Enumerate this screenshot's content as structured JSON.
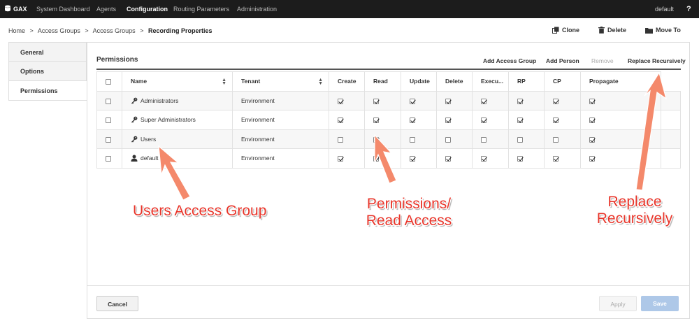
{
  "topnav": {
    "brand": "GAX",
    "items": [
      "System Dashboard",
      "Agents",
      "Configuration",
      "Routing Parameters",
      "Administration"
    ],
    "active": "Configuration",
    "user": "default",
    "help": "?"
  },
  "breadcrumb": {
    "items": [
      "Home",
      "Access Groups",
      "Access Groups"
    ],
    "separator": ">",
    "current": "Recording Properties"
  },
  "toolbar": {
    "clone": "Clone",
    "delete": "Delete",
    "move_to": "Move To"
  },
  "sidetabs": [
    "General",
    "Options",
    "Permissions"
  ],
  "active_tab": "Permissions",
  "panel": {
    "title": "Permissions",
    "actions": {
      "add_access_group": "Add Access Group",
      "add_person": "Add Person",
      "remove": "Remove",
      "replace_recursively": "Replace Recursively"
    }
  },
  "table": {
    "columns": [
      "Name",
      "Tenant",
      "Create",
      "Read",
      "Update",
      "Delete",
      "Execu...",
      "RP",
      "CP",
      "Propagate"
    ],
    "rows": [
      {
        "name": "Administrators",
        "icon": "key-icon",
        "tenant": "Environment",
        "perms": [
          true,
          true,
          true,
          true,
          true,
          true,
          true,
          true
        ]
      },
      {
        "name": "Super Administrators",
        "icon": "key-icon",
        "tenant": "Environment",
        "perms": [
          true,
          true,
          true,
          true,
          true,
          true,
          true,
          true
        ]
      },
      {
        "name": "Users",
        "icon": "key-icon",
        "tenant": "Environment",
        "perms": [
          false,
          true,
          false,
          false,
          false,
          false,
          false,
          true
        ]
      },
      {
        "name": "default",
        "icon": "user-icon",
        "tenant": "Environment",
        "perms": [
          true,
          true,
          true,
          true,
          true,
          true,
          true,
          true
        ]
      }
    ]
  },
  "footer": {
    "cancel": "Cancel",
    "apply": "Apply",
    "save": "Save"
  },
  "annotations": {
    "users_group": "Users Access Group",
    "read_access_line1": "Permissions/",
    "read_access_line2": "Read Access",
    "replace_line1": "Replace",
    "replace_line2": "Recursively"
  },
  "colors": {
    "annotation": "#e8352a",
    "arrow": "#f4896b",
    "save_button": "#aec8e8",
    "topbar": "#1c1c1c"
  }
}
